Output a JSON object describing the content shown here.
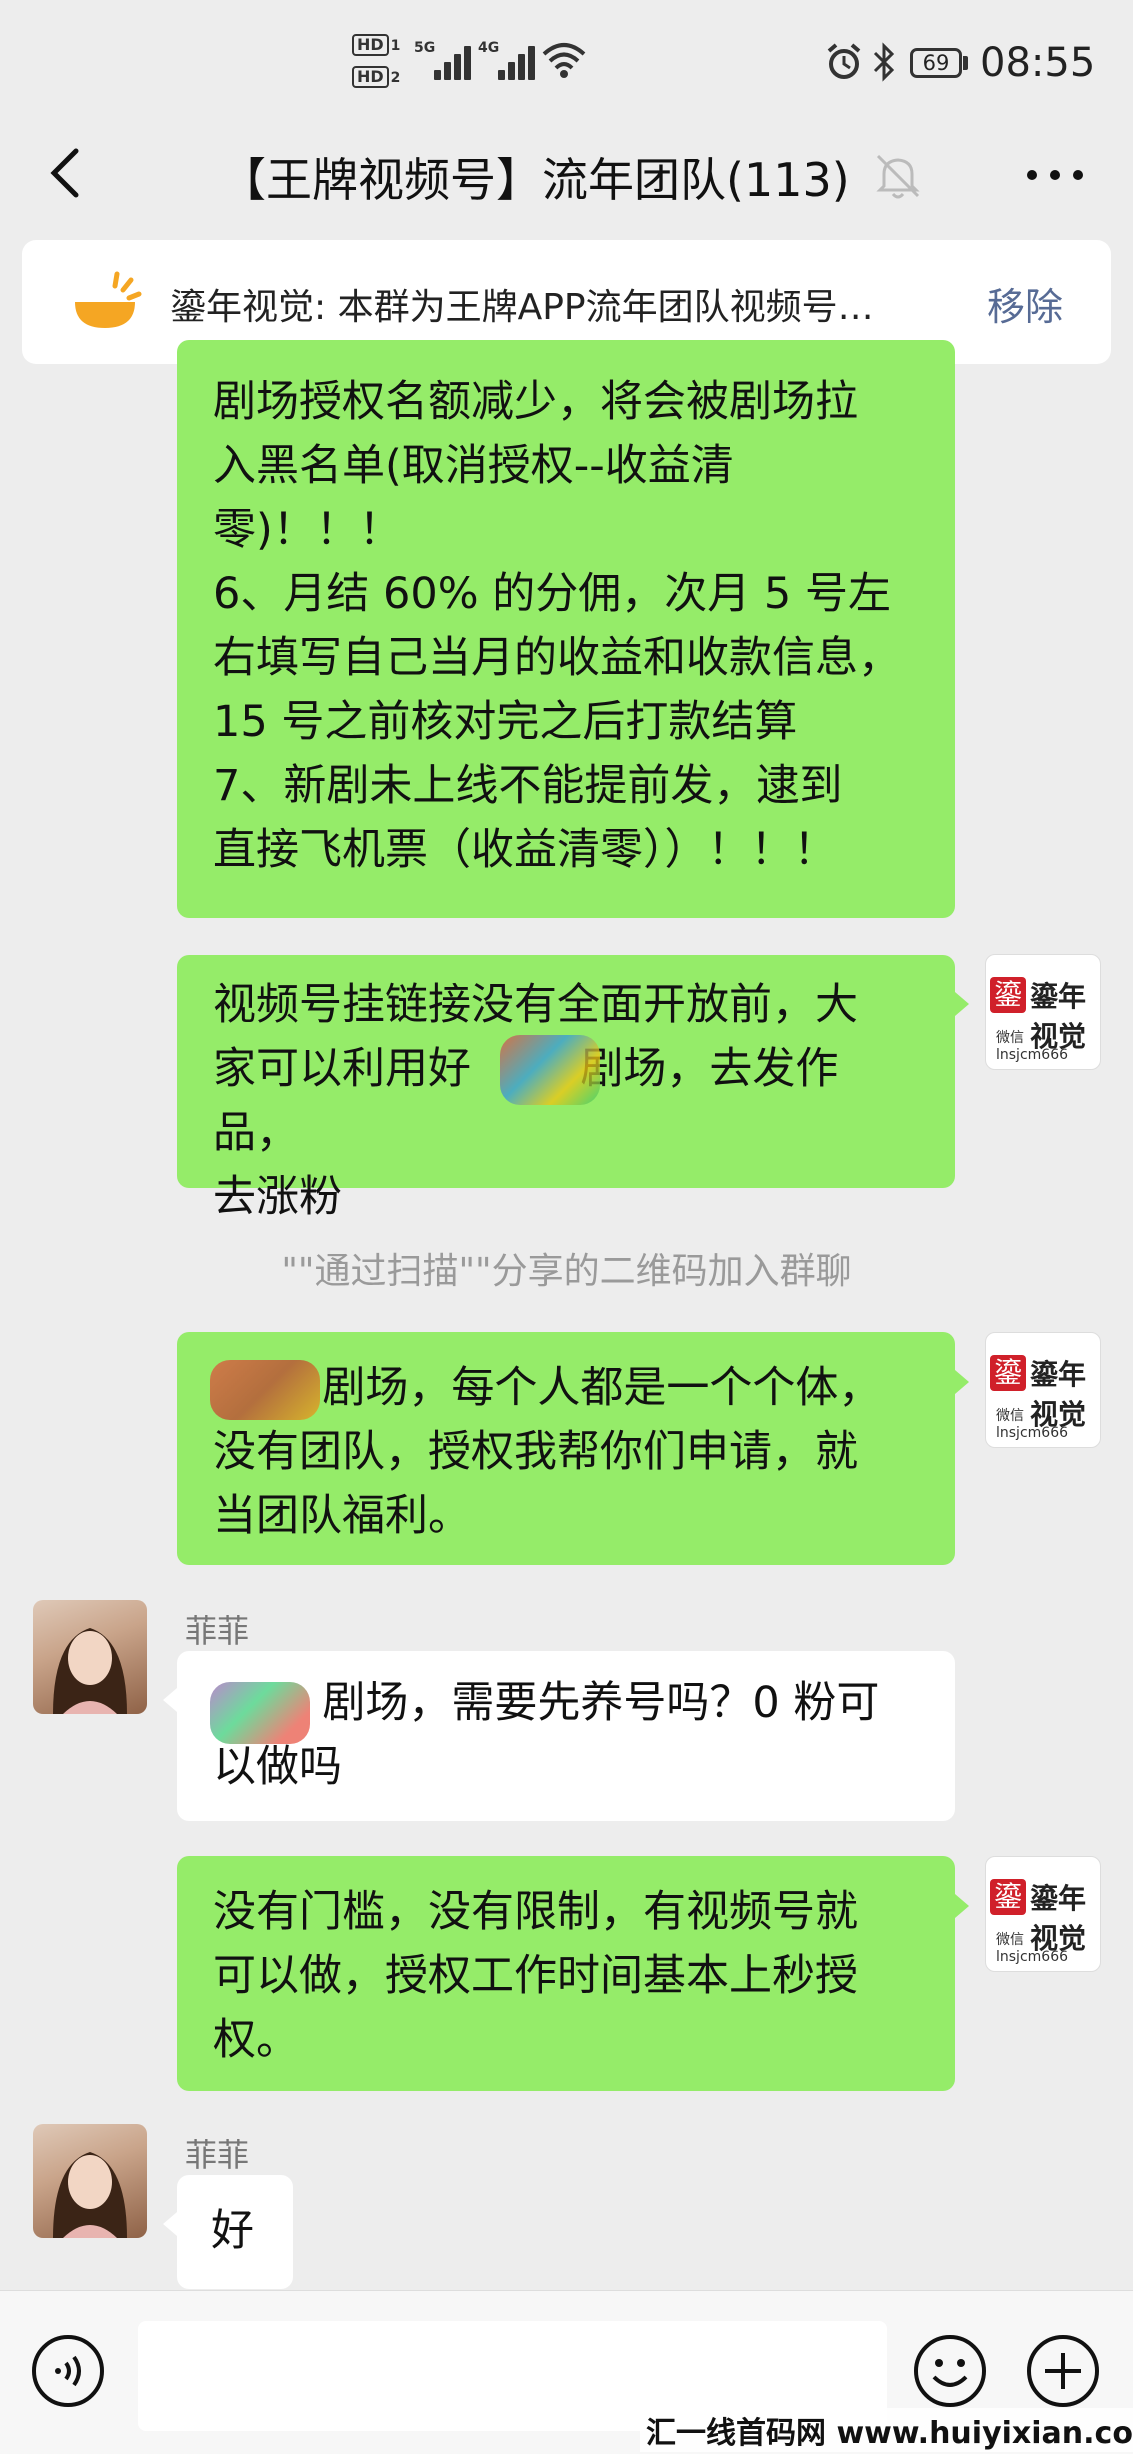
{
  "status_bar": {
    "hd1": "HD",
    "hd1_num": "1",
    "hd2": "HD",
    "hd2_num": "2",
    "net1": "5G",
    "net2": "4G",
    "battery": "69",
    "time": "08:55"
  },
  "title_bar": {
    "title": "【王牌视频号】流年团队(113)"
  },
  "notice": {
    "text": "鎏年视觉: 本群为王牌APP流年团队视频号…",
    "remove_label": "移除"
  },
  "brand_avatar": {
    "name": "鎏年视觉",
    "mark": "鎏",
    "wechat": "微信  lnsjcm666"
  },
  "messages": [
    {
      "lines": "剧场授权名额减少，将会被剧场拉\n入黑名单(取消授权--收益清\n零)！！！\n6、月结 60% 的分佣，次月 5 号左\n右填写自己当月的收益和收款信息，\n15 号之前核对完之后打款结算\n7、新剧未上线不能提前发，逮到\n直接飞机票（收益清零））！！！"
    },
    {
      "lines": "视频号挂链接没有全面开放前，大\n家可以利用好        剧场，去发作品，\n去涨粉"
    },
    {
      "system": "\"\"通过扫描\"\"分享的二维码加入群聊"
    },
    {
      "lines": "        剧场，每个人都是一个个体，\n没有团队，授权我帮你们申请，就\n当团队福利。"
    },
    {
      "sender": "菲菲",
      "lines": "        剧场，需要先养号吗？0 粉可\n以做吗"
    },
    {
      "lines": "没有门槛，没有限制，有视频号就\n可以做，授权工作时间基本上秒授\n权。"
    },
    {
      "sender": "菲菲",
      "lines": "好"
    }
  ],
  "watermark": "汇一线首码网  www.huiyixian.com",
  "colors": {
    "self_bubble": "#95ec69",
    "other_bubble": "#ffffff",
    "background": "#ededed",
    "link": "#576b95"
  }
}
